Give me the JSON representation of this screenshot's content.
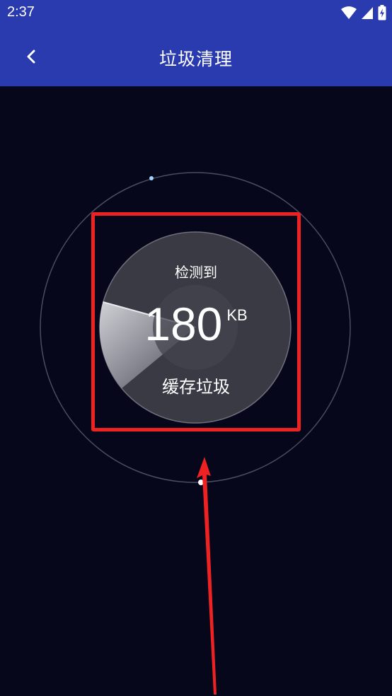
{
  "status_bar": {
    "time": "2:37"
  },
  "app_bar": {
    "title": "垃圾清理",
    "back_icon": "chevron-left-icon"
  },
  "scan": {
    "detected_label": "检测到",
    "size_value": "180",
    "size_unit": "KB",
    "category_label": "缓存垃圾"
  },
  "colors": {
    "app_bar": "#2a3bb0",
    "background": "#06071a",
    "highlight": "#ee2222"
  }
}
